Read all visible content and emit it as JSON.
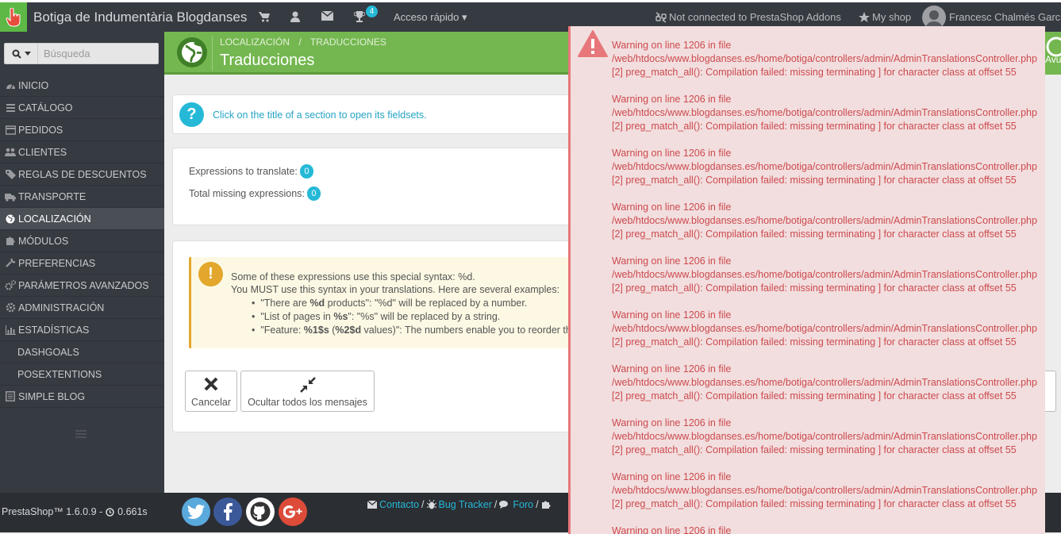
{
  "topbar": {
    "shop_name": "Botiga de Indumentària Blogdanses",
    "notifications_count": "4",
    "quick_access": "Acceso rápido ▾",
    "addons_status": "Not connected to PrestaShop Addons",
    "my_shop": "My shop",
    "employee": "Francesc Chalmés García"
  },
  "sidebar": {
    "search_placeholder": "Búsqueda",
    "items": [
      {
        "label": "INICIO",
        "icon": "dashboard-icon"
      },
      {
        "label": "CATÁLOGO",
        "icon": "catalog-icon"
      },
      {
        "label": "PEDIDOS",
        "icon": "orders-icon"
      },
      {
        "label": "CLIENTES",
        "icon": "users-icon"
      },
      {
        "label": "REGLAS DE DESCUENTOS",
        "icon": "tag-icon"
      },
      {
        "label": "TRANSPORTE",
        "icon": "truck-icon"
      },
      {
        "label": "LOCALIZACIÓN",
        "icon": "globe-icon",
        "active": true
      },
      {
        "label": "MÓDULOS",
        "icon": "puzzle-icon"
      },
      {
        "label": "PREFERENCIAS",
        "icon": "wrench-icon"
      },
      {
        "label": "PARÁMETROS AVANZADOS",
        "icon": "cogs-icon"
      },
      {
        "label": "ADMINISTRACIÓN",
        "icon": "cog-icon"
      },
      {
        "label": "ESTADÍSTICAS",
        "icon": "bar-chart-icon"
      },
      {
        "label": "DASHGOALS",
        "icon": ""
      },
      {
        "label": "POSEXTENTIONS",
        "icon": ""
      },
      {
        "label": "SIMPLE BLOG",
        "icon": "doc-icon"
      }
    ]
  },
  "page": {
    "breadcrumb_1": "LOCALIZACIÓN",
    "breadcrumb_sep": "/",
    "breadcrumb_2": "TRADUCCIONES",
    "title": "Traducciones",
    "help_fragment": "Ayu"
  },
  "info": {
    "text": "Click on the title of a section to open its fieldsets."
  },
  "stats": {
    "to_translate_label": "Expressions to translate:",
    "to_translate_count": "0",
    "missing_label": "Total missing expressions:",
    "missing_count": "0"
  },
  "syntax_warning": {
    "line1": "Some of these expressions use this special syntax: %d.",
    "line2": "You MUST use this syntax in your translations. Here are several examples:",
    "b1_pre": "\"There are ",
    "b1_bold": "%d",
    "b1_post": " products\": \"%d\" will be replaced by a number.",
    "b2_pre": "\"List of pages in ",
    "b2_bold": "%s",
    "b2_post": "\": \"%s\" will be replaced by a string.",
    "b3_pre": "\"Feature: ",
    "b3_bold1": "%1$s",
    "b3_mid": " (",
    "b3_bold2": "%2$d",
    "b3_post": " values)\": The numbers enable you to reorder the"
  },
  "buttons": {
    "cancel": "Cancelar",
    "hide_all": "Ocultar todos los mensajes",
    "right_fragment": "r"
  },
  "errors": {
    "line1": "Warning on line 1206 in file",
    "line2": "/web/htdocs/www.blogdanses.es/home/botiga/controllers/admin/AdminTranslationsController.php",
    "line3": "[2] preg_match_all(): Compilation failed: missing terminating ] for character class at offset 55",
    "partial": "Warning on line 1206 in file"
  },
  "footer": {
    "version": "PrestaShop™ 1.6.0.9 -",
    "load_time": "0.661s",
    "contact": "Contacto",
    "bug_tracker": "Bug Tracker",
    "forum": "Foro",
    "sep": "/"
  }
}
